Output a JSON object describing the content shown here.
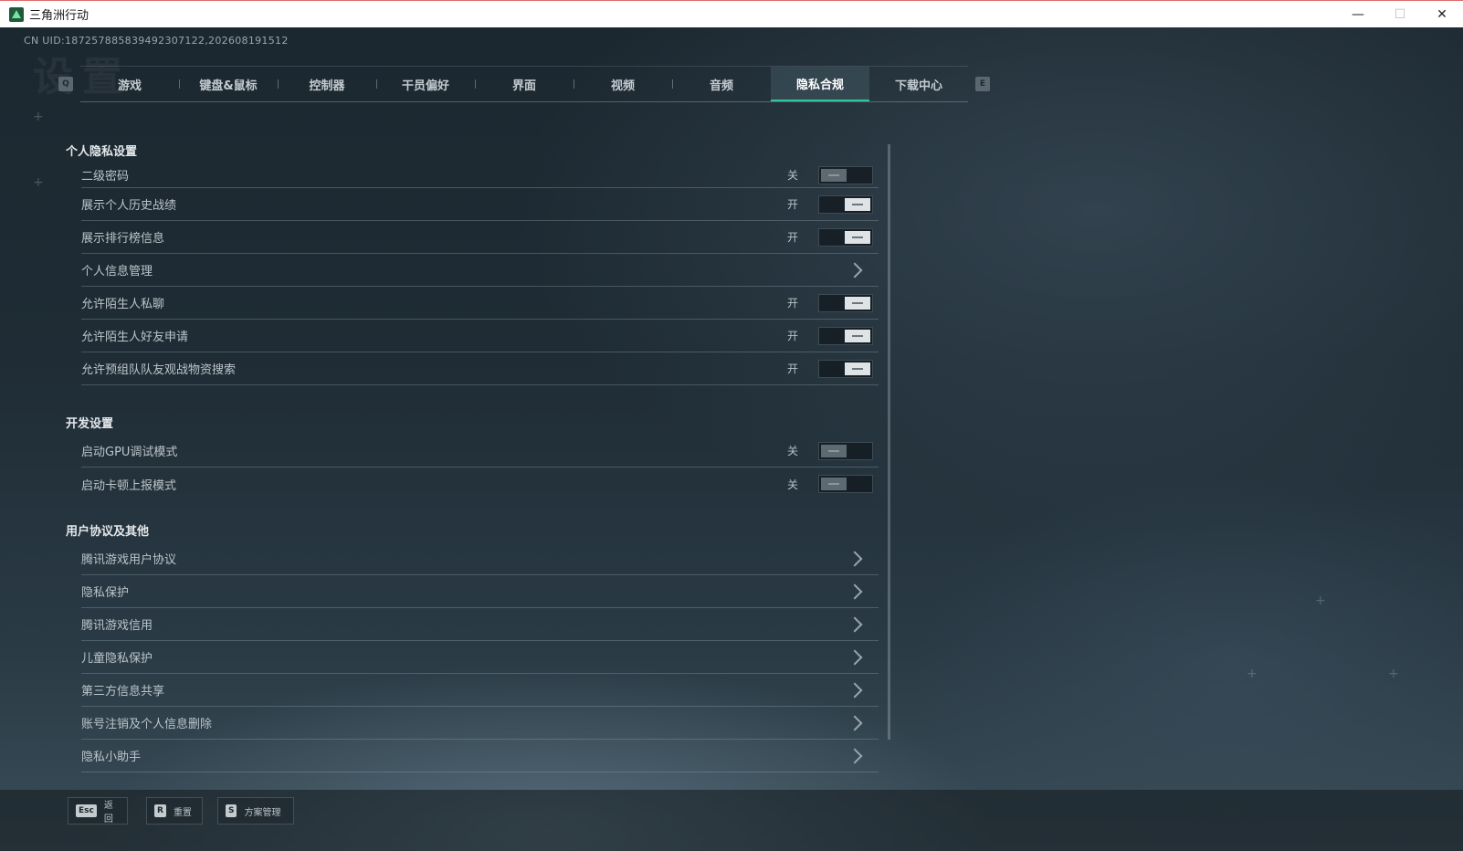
{
  "window": {
    "title": "三角洲行动",
    "controls": {
      "minimize": "—",
      "maximize": "☐",
      "close": "✕"
    }
  },
  "uid_text": "CN UID:1872578858394923071​22,202608191512",
  "bg_title": "设置",
  "tabs": {
    "left_key": "Q",
    "right_key": "E",
    "items": [
      {
        "label": "游戏",
        "active": false
      },
      {
        "label": "键盘&鼠标",
        "active": false
      },
      {
        "label": "控制器",
        "active": false
      },
      {
        "label": "干员偏好",
        "active": false
      },
      {
        "label": "界面",
        "active": false
      },
      {
        "label": "视频",
        "active": false
      },
      {
        "label": "音频",
        "active": false
      },
      {
        "label": "隐私合规",
        "active": true
      },
      {
        "label": "下载中心",
        "active": false
      }
    ]
  },
  "sections": {
    "privacy": {
      "title": "个人隐私设置",
      "rows": [
        {
          "label": "二级密码",
          "state": "关",
          "on": false
        },
        {
          "label": "展示个人历史战绩",
          "state": "开",
          "on": true
        },
        {
          "label": "展示排行榜信息",
          "state": "开",
          "on": true
        },
        {
          "label": "个人信息管理"
        },
        {
          "label": "允许陌生人私聊",
          "state": "开",
          "on": true
        },
        {
          "label": "允许陌生人好友申请",
          "state": "开",
          "on": true
        },
        {
          "label": "允许预组队队友观战物资搜索",
          "state": "开",
          "on": true
        }
      ]
    },
    "dev": {
      "title": "开发设置",
      "rows": [
        {
          "label": "启动GPU调试模式",
          "state": "关",
          "on": false
        },
        {
          "label": "启动卡顿上报模式",
          "state": "关",
          "on": false
        }
      ]
    },
    "agreements": {
      "title": "用户协议及其他",
      "rows": [
        {
          "label": "腾讯游戏用户协议"
        },
        {
          "label": "隐私保护"
        },
        {
          "label": "腾讯游戏信用"
        },
        {
          "label": "儿童隐私保护"
        },
        {
          "label": "第三方信息共享"
        },
        {
          "label": "账号注销及个人信息删除"
        },
        {
          "label": "隐私小助手"
        }
      ]
    }
  },
  "footer": {
    "back": {
      "key": "Esc",
      "label": "返回"
    },
    "reset": {
      "key": "R",
      "label": "重置"
    },
    "scheme": {
      "key": "S",
      "label": "方案管理"
    }
  }
}
